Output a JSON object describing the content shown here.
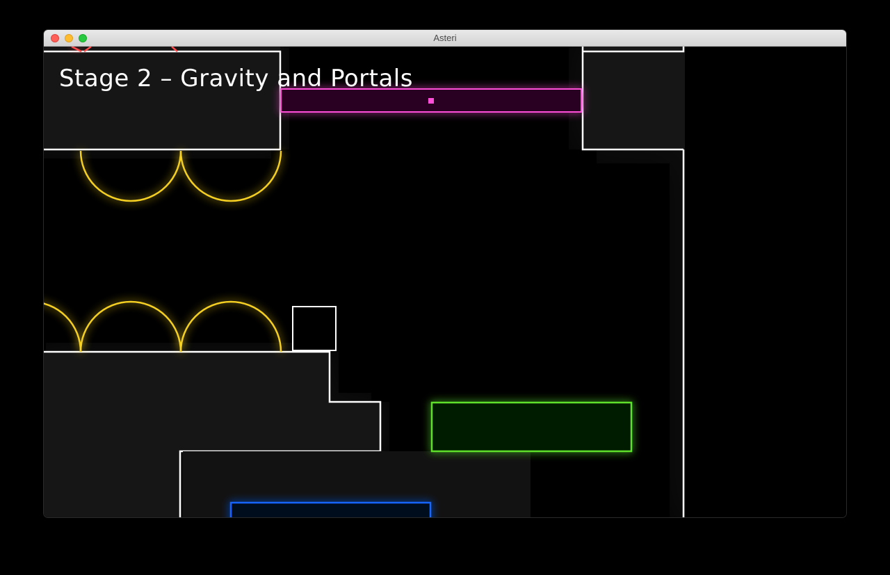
{
  "window": {
    "title": "Asteri"
  },
  "hud": {
    "stage_title": "Stage 2 – Gravity and Portals"
  },
  "colors": {
    "wall": "#ffffff",
    "wall_fill": "#171717",
    "hazard": "#f5d020",
    "portal": "#ff4fd8",
    "goal": "#5ee02a",
    "water": "#1565ff"
  }
}
